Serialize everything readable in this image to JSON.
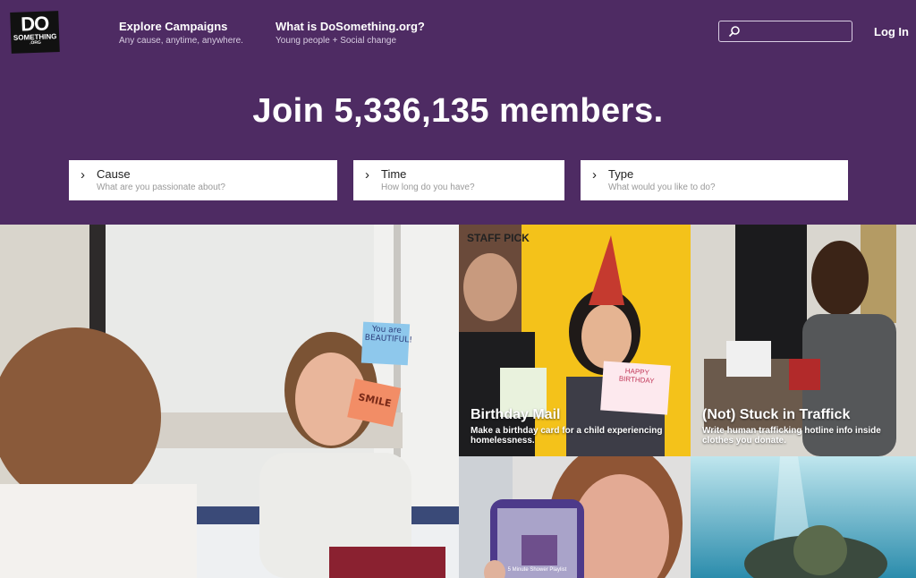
{
  "header": {
    "logo": {
      "line1": "DO",
      "line2": "SOMETHING",
      "line3": ".ORG"
    },
    "nav": [
      {
        "title": "Explore Campaigns",
        "subtitle": "Any cause, anytime, anywhere."
      },
      {
        "title": "What is DoSomething.org?",
        "subtitle": "Young people + Social change"
      }
    ],
    "search": {
      "placeholder": "",
      "value": ""
    },
    "login_label": "Log In"
  },
  "headline": "Join 5,336,135 members.",
  "filters": [
    {
      "label": "Cause",
      "placeholder": "What are you passionate about?"
    },
    {
      "label": "Time",
      "placeholder": "How long do you have?"
    },
    {
      "label": "Type",
      "placeholder": "What would you like to do?"
    }
  ],
  "notes": {
    "note1": "You are BEAUTIFUL!",
    "note2": "SMILE"
  },
  "campaigns": [
    {
      "badge": "STAFF PICK",
      "title": "Birthday Mail",
      "description": "Make a birthday card for a child experiencing homelessness.",
      "card_text": "HAPPY BIRTHDAY"
    },
    {
      "badge": "",
      "title": "(Not) Stuck in Traffick",
      "description": "Write human trafficking hotline info inside clothes you donate."
    }
  ],
  "phone_text": "5 Minute Shower Playlist",
  "colors": {
    "brand_purple": "#4e2b63",
    "staff_pick_yellow": "#f4c21a",
    "white": "#ffffff"
  },
  "icons": [
    "search-icon",
    "chevron-right-icon"
  ]
}
